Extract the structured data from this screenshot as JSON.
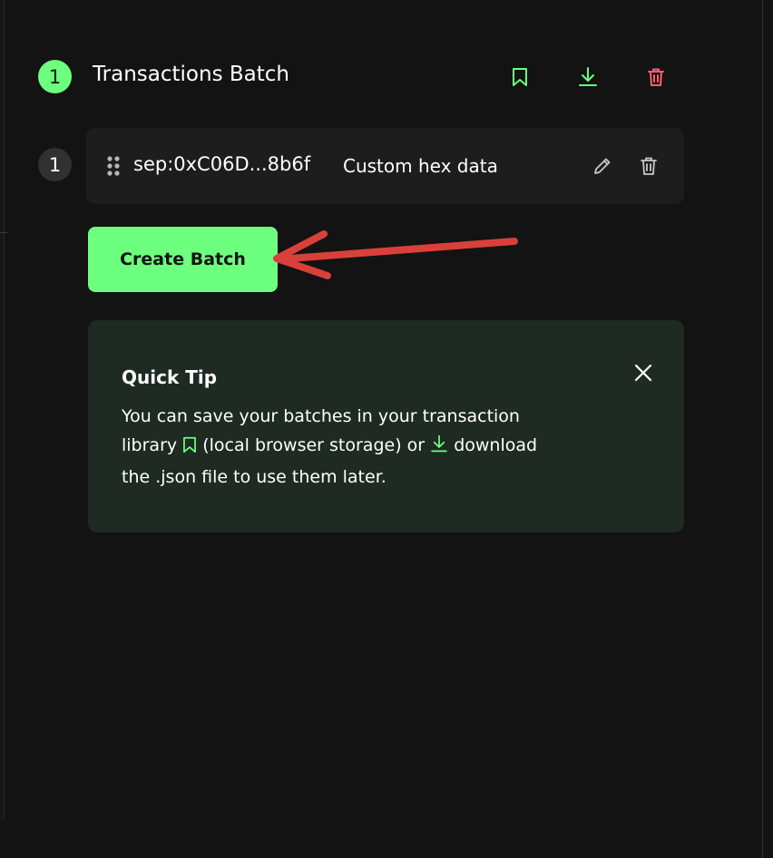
{
  "colors": {
    "background": "#121312",
    "accent_green": "#6dff7e",
    "danger_red": "#ff5f72",
    "card_bg": "#1c1d1c",
    "tip_bg": "#1f2a23",
    "annotation_arrow": "#d9403a"
  },
  "batch": {
    "number": "1",
    "title": "Transactions Batch",
    "actions": [
      "bookmark-icon",
      "download-icon",
      "trash-icon"
    ]
  },
  "transactions": [
    {
      "index": "1",
      "address": "sep:0xC06D...8b6f",
      "description": "Custom hex data",
      "actions": [
        "pencil-icon",
        "trash-icon"
      ]
    }
  ],
  "create_batch": {
    "label": "Create Batch"
  },
  "quick_tip": {
    "title": "Quick Tip",
    "line1": "You can save your batches in your transaction",
    "line2_a": "library",
    "line2_b": "(local browser storage) or",
    "line2_c": "download",
    "line3": "the .json file to use them later."
  }
}
